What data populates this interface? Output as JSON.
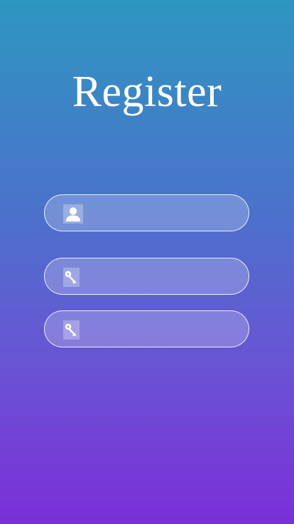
{
  "page": {
    "title": "Register"
  },
  "form": {
    "fields": [
      {
        "icon": "user-icon",
        "value": "",
        "placeholder": ""
      },
      {
        "icon": "key-icon",
        "value": "",
        "placeholder": ""
      },
      {
        "icon": "key-icon",
        "value": "",
        "placeholder": ""
      }
    ]
  },
  "colors": {
    "gradient_top": "#2e96c0",
    "gradient_bottom": "#7b2fd8",
    "text": "#ffffff"
  }
}
